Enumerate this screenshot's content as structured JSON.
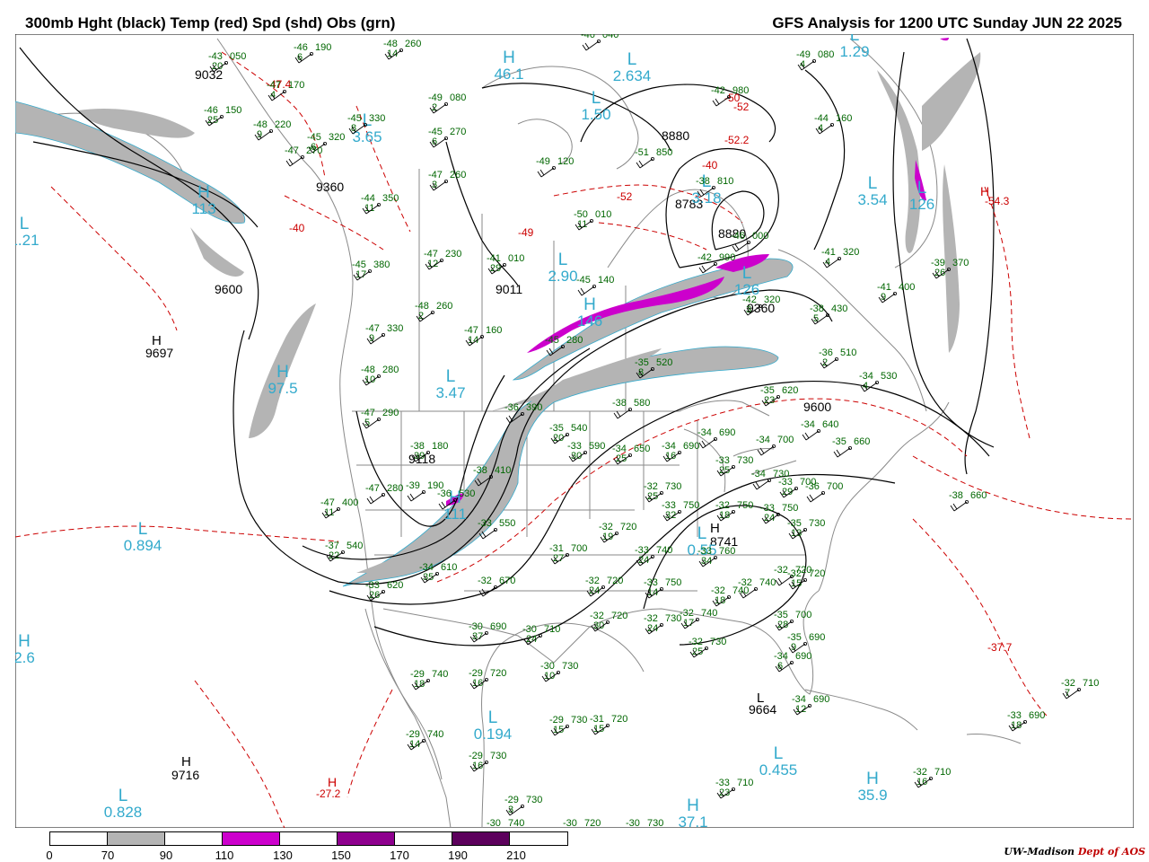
{
  "header": {
    "title": "300mb Hght (black) Temp (red) Spd (shd) Obs (grn)",
    "valid": "GFS Analysis for 1200 UTC Sunday  JUN 22 2025"
  },
  "colors": {
    "height": "#000000",
    "temperature": "#cc0000",
    "obs": "#006600",
    "centers": "#33aacc",
    "shade_70": "#b4b4b4",
    "shade_110": "#cc00cc",
    "shade_150": "#8e008e",
    "shade_190": "#5c005c",
    "map_lines": "#808080"
  },
  "legend": {
    "labels": [
      "0",
      "70",
      "90",
      "110",
      "130",
      "150",
      "170",
      "190",
      "210"
    ],
    "cells": [
      "#ffffff",
      "#b4b4b4",
      "#ffffff",
      "#cc00cc",
      "#ffffff",
      "#8e008e",
      "#ffffff",
      "#5c005c",
      "#ffffff"
    ]
  },
  "credit": {
    "org": "UW-Madison",
    "dept": "Dept of AOS"
  },
  "height_labels": [
    "9032",
    "9360",
    "9600",
    "9697",
    "9011",
    "8880",
    "8783",
    "8880",
    "9360",
    "9600",
    "9118",
    "8741",
    "9664",
    "9716"
  ],
  "centers": [
    {
      "kind": "L",
      "value": "1.21"
    },
    {
      "kind": "H",
      "value": "113"
    },
    {
      "kind": "L",
      "value": "3.65"
    },
    {
      "kind": "H",
      "value": "46.1"
    },
    {
      "kind": "L",
      "value": "1.50"
    },
    {
      "kind": "L",
      "value": "2.634"
    },
    {
      "kind": "L",
      "value": "1.29"
    },
    {
      "kind": "L",
      "value": "3.54"
    },
    {
      "kind": "L",
      "value": "126"
    },
    {
      "kind": "L",
      "value": "2.90"
    },
    {
      "kind": "H",
      "value": "146"
    },
    {
      "kind": "L",
      "value": "3.47"
    },
    {
      "kind": "H",
      "value": "97.5"
    },
    {
      "kind": "H",
      "value": "111"
    },
    {
      "kind": "L",
      "value": "0.894"
    },
    {
      "kind": "L",
      "value": "0.194"
    },
    {
      "kind": "L",
      "value": "0.455"
    },
    {
      "kind": "H",
      "value": "35.9"
    },
    {
      "kind": "H",
      "value": "37.1"
    },
    {
      "kind": "L",
      "value": "0.828"
    },
    {
      "kind": "H",
      "value": "2.6"
    },
    {
      "kind": "L",
      "value": "3.18"
    },
    {
      "kind": "L",
      "value": "126"
    },
    {
      "kind": "L",
      "value": "0.55"
    }
  ],
  "temp_labels": [
    "-47.4",
    "-50",
    "-49",
    "-52",
    "-52.2",
    "-52",
    "-40",
    "-54.3",
    "-40",
    "-37.7",
    "-27.2"
  ],
  "temp_highs": [
    "H",
    "H"
  ],
  "obs": [
    {
      "t": "-43",
      "h": "050",
      "d": "20"
    },
    {
      "t": "-46",
      "h": "190",
      "d": "6"
    },
    {
      "t": "-48",
      "h": "260",
      "d": "14"
    },
    {
      "t": "-46",
      "h": "040",
      "d": ""
    },
    {
      "t": "-47",
      "h": "170",
      "d": "4"
    },
    {
      "t": "-46",
      "h": "150",
      "d": "25"
    },
    {
      "t": "-45",
      "h": "330",
      "d": "8"
    },
    {
      "t": "-48",
      "h": "220",
      "d": "9"
    },
    {
      "t": "-45",
      "h": "320",
      "d": "6"
    },
    {
      "t": "-47",
      "h": "270",
      "d": ""
    },
    {
      "t": "-45",
      "h": "270",
      "d": "6"
    },
    {
      "t": "-49",
      "h": "080",
      "d": "2"
    },
    {
      "t": "-51",
      "h": "850",
      "d": ""
    },
    {
      "t": "-49",
      "h": "120",
      "d": ""
    },
    {
      "t": "-47",
      "h": "260",
      "d": "3"
    },
    {
      "t": "-44",
      "h": "350",
      "d": "11"
    },
    {
      "t": "-50",
      "h": "010",
      "d": "11"
    },
    {
      "t": "-47",
      "h": "230",
      "d": "12"
    },
    {
      "t": "-41",
      "h": "010",
      "d": "29"
    },
    {
      "t": "-45",
      "h": "380",
      "d": "17"
    },
    {
      "t": "-48",
      "h": "260",
      "d": "2"
    },
    {
      "t": "-47",
      "h": "330",
      "d": "9"
    },
    {
      "t": "-47",
      "h": "160",
      "d": "14"
    },
    {
      "t": "-48",
      "h": "280",
      "d": "10"
    },
    {
      "t": "-47",
      "h": "290",
      "d": "5"
    },
    {
      "t": "-49",
      "h": "080",
      "d": "4"
    },
    {
      "t": "-44",
      "h": "160",
      "d": "4"
    },
    {
      "t": "-42",
      "h": "980",
      "d": ""
    },
    {
      "t": "-38",
      "h": "810",
      "d": ""
    },
    {
      "t": "-46",
      "h": "000",
      "d": ""
    },
    {
      "t": "-42",
      "h": "990",
      "d": ""
    },
    {
      "t": "-41",
      "h": "320",
      "d": "4"
    },
    {
      "t": "-39",
      "h": "370",
      "d": "26"
    },
    {
      "t": "-41",
      "h": "400",
      "d": "9"
    },
    {
      "t": "-42",
      "h": "320",
      "d": "3"
    },
    {
      "t": "-38",
      "h": "430",
      "d": "5"
    },
    {
      "t": "-36",
      "h": "510",
      "d": "2"
    },
    {
      "t": "-34",
      "h": "530",
      "d": "4"
    },
    {
      "t": "-45",
      "h": "140",
      "d": ""
    },
    {
      "t": "-45",
      "h": "280",
      "d": ""
    },
    {
      "t": "-35",
      "h": "520",
      "d": "8"
    },
    {
      "t": "-35",
      "h": "620",
      "d": "23"
    },
    {
      "t": "-36",
      "h": "390",
      "d": ""
    },
    {
      "t": "-38",
      "h": "580",
      "d": ""
    },
    {
      "t": "-34",
      "h": "640",
      "d": ""
    },
    {
      "t": "-35",
      "h": "540",
      "d": "20"
    },
    {
      "t": "-33",
      "h": "590",
      "d": "30"
    },
    {
      "t": "-34",
      "h": "650",
      "d": "25"
    },
    {
      "t": "-34",
      "h": "690",
      "d": "16"
    },
    {
      "t": "-34",
      "h": "690",
      "d": ""
    },
    {
      "t": "-34",
      "h": "700",
      "d": ""
    },
    {
      "t": "-35",
      "h": "660",
      "d": ""
    },
    {
      "t": "-38",
      "h": "180",
      "d": "39"
    },
    {
      "t": "-33",
      "h": "730",
      "d": "25"
    },
    {
      "t": "-34",
      "h": "730",
      "d": ""
    },
    {
      "t": "-33",
      "h": "700",
      "d": "29"
    },
    {
      "t": "-36",
      "h": "700",
      "d": ""
    },
    {
      "t": "-38",
      "h": "660",
      "d": ""
    },
    {
      "t": "-38",
      "h": "410",
      "d": ""
    },
    {
      "t": "-39",
      "h": "190",
      "d": ""
    },
    {
      "t": "-47",
      "h": "280",
      "d": ""
    },
    {
      "t": "-47",
      "h": "400",
      "d": "11"
    },
    {
      "t": "-36",
      "h": "530",
      "d": ""
    },
    {
      "t": "-32",
      "h": "730",
      "d": "25"
    },
    {
      "t": "-33",
      "h": "750",
      "d": "32"
    },
    {
      "t": "-32",
      "h": "750",
      "d": "18"
    },
    {
      "t": "-33",
      "h": "750",
      "d": "24"
    },
    {
      "t": "-35",
      "h": "730",
      "d": "13"
    },
    {
      "t": "-33",
      "h": "550",
      "d": ""
    },
    {
      "t": "-37",
      "h": "540",
      "d": "22"
    },
    {
      "t": "-32",
      "h": "720",
      "d": "19"
    },
    {
      "t": "-31",
      "h": "700",
      "d": "27"
    },
    {
      "t": "-33",
      "h": "740",
      "d": "24"
    },
    {
      "t": "-33",
      "h": "760",
      "d": "34"
    },
    {
      "t": "-32",
      "h": "720",
      "d": ""
    },
    {
      "t": "-34",
      "h": "610",
      "d": "35"
    },
    {
      "t": "-33",
      "h": "620",
      "d": "26"
    },
    {
      "t": "-32",
      "h": "670",
      "d": ""
    },
    {
      "t": "-32",
      "h": "720",
      "d": "24"
    },
    {
      "t": "-33",
      "h": "750",
      "d": "14"
    },
    {
      "t": "-32",
      "h": "740",
      "d": "18"
    },
    {
      "t": "-32",
      "h": "740",
      "d": ""
    },
    {
      "t": "-32",
      "h": "720",
      "d": "15"
    },
    {
      "t": "-32",
      "h": "720",
      "d": "30"
    },
    {
      "t": "-32",
      "h": "730",
      "d": "24"
    },
    {
      "t": "-32",
      "h": "740",
      "d": "17"
    },
    {
      "t": "-35",
      "h": "700",
      "d": "28"
    },
    {
      "t": "-30",
      "h": "690",
      "d": "37"
    },
    {
      "t": "-30",
      "h": "710",
      "d": "24"
    },
    {
      "t": "-32",
      "h": "730",
      "d": "25"
    },
    {
      "t": "-35",
      "h": "690",
      "d": "9"
    },
    {
      "t": "-34",
      "h": "690",
      "d": "6"
    },
    {
      "t": "-30",
      "h": "730",
      "d": "10"
    },
    {
      "t": "-29",
      "h": "740",
      "d": "18"
    },
    {
      "t": "-29",
      "h": "720",
      "d": "16"
    },
    {
      "t": "-34",
      "h": "690",
      "d": "12"
    },
    {
      "t": "-29",
      "h": "730",
      "d": "15"
    },
    {
      "t": "-31",
      "h": "720",
      "d": "15"
    },
    {
      "t": "-29",
      "h": "740",
      "d": "14"
    },
    {
      "t": "-29",
      "h": "730",
      "d": "16"
    },
    {
      "t": "-33",
      "h": "710",
      "d": "23"
    },
    {
      "t": "-32",
      "h": "710",
      "d": "16"
    },
    {
      "t": "-29",
      "h": "730",
      "d": "3"
    },
    {
      "t": "-30",
      "h": "740",
      "d": ""
    },
    {
      "t": "-30",
      "h": "720",
      "d": ""
    },
    {
      "t": "-30",
      "h": "730",
      "d": ""
    },
    {
      "t": "-32",
      "h": "710",
      "d": "7"
    },
    {
      "t": "-33",
      "h": "690",
      "d": "18"
    }
  ]
}
